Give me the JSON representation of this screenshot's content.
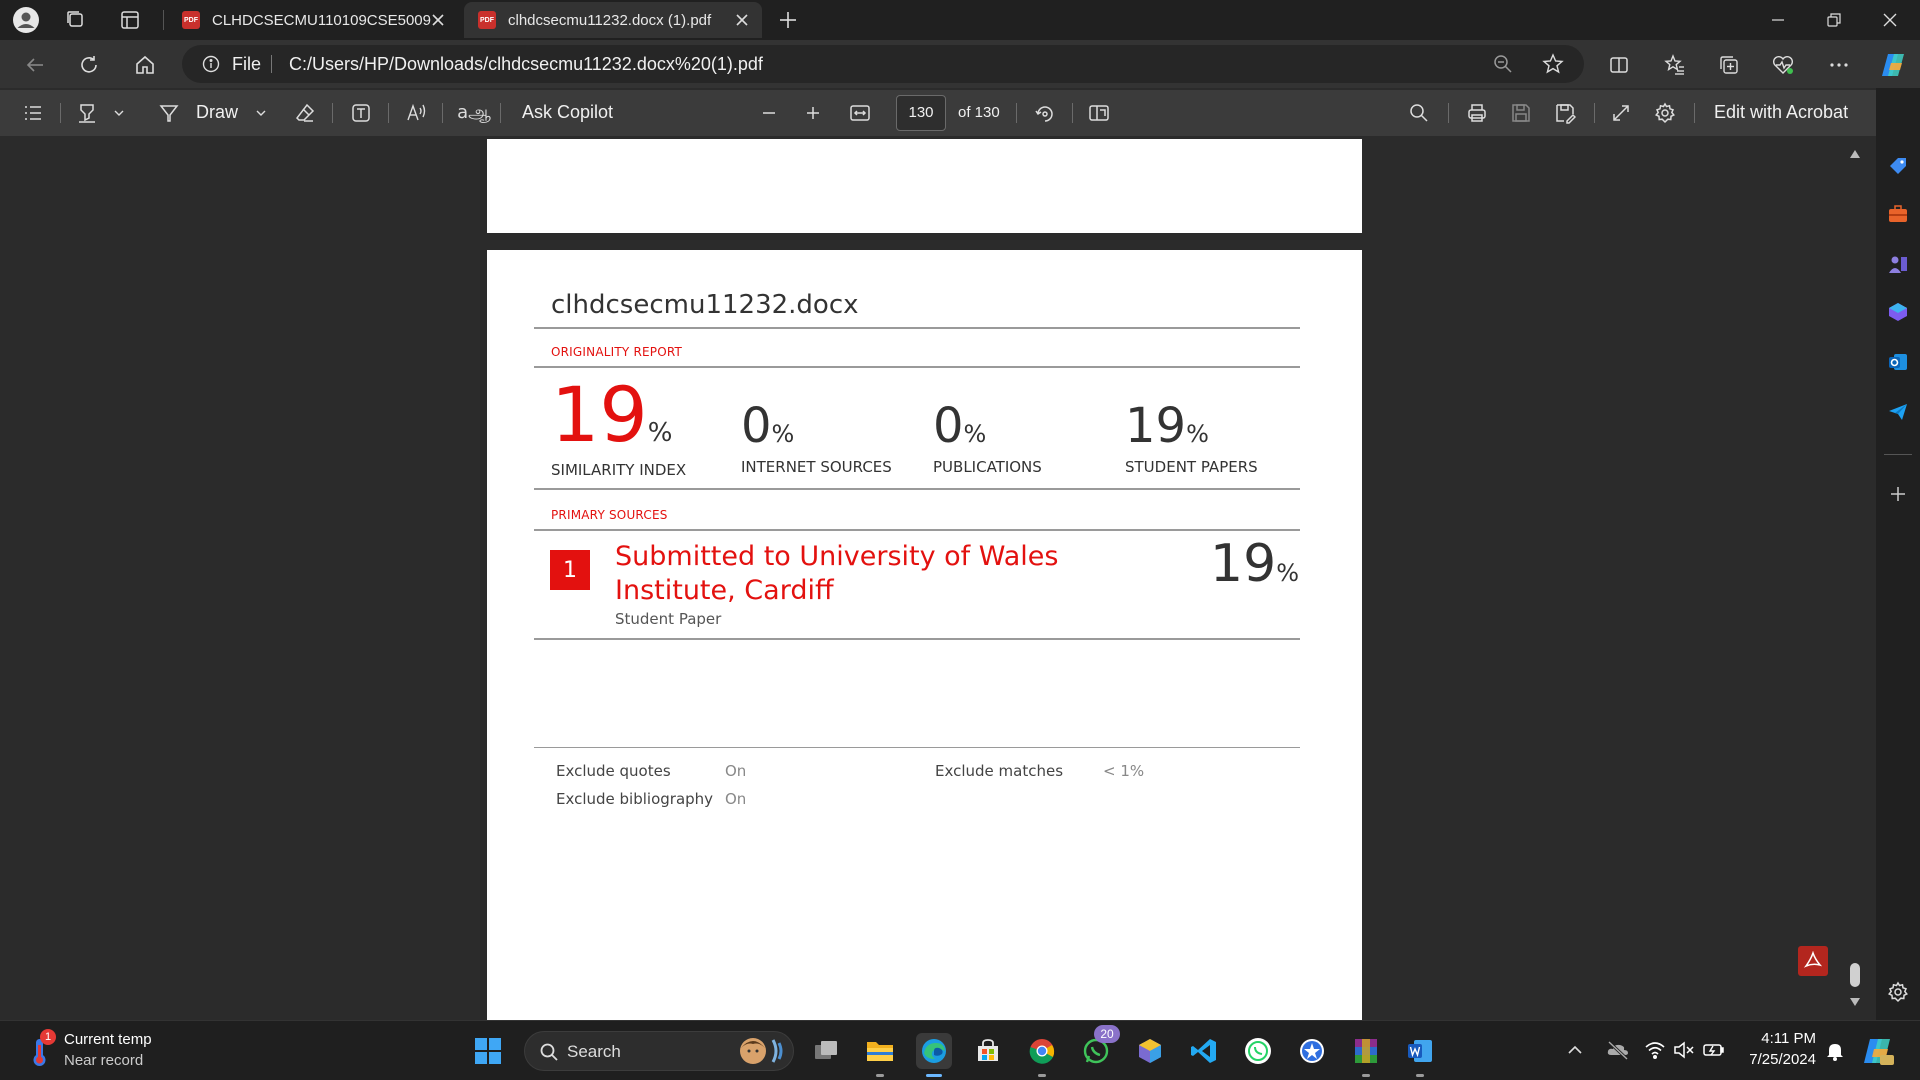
{
  "browser": {
    "tabs": [
      {
        "title": "CLHDCSECMU110109CSE5009.pdf",
        "active": false
      },
      {
        "title": "clhdcsecmu11232.docx (1).pdf",
        "active": true
      }
    ],
    "address_prefix": "File",
    "url": "C:/Users/HP/Downloads/clhdcsecmu11232.docx%20(1).pdf"
  },
  "pdf_toolbar": {
    "draw_label": "Draw",
    "ask_copilot_label": "Ask Copilot",
    "page_current": "130",
    "page_total_label": "of 130",
    "edit_label": "Edit with Acrobat"
  },
  "report": {
    "title": "clhdcsecmu11232.docx",
    "section_originality": "ORIGINALITY REPORT",
    "stats": [
      {
        "value": "19",
        "unit": "%",
        "label": "SIMILARITY INDEX"
      },
      {
        "value": "0",
        "unit": "%",
        "label": "INTERNET SOURCES"
      },
      {
        "value": "0",
        "unit": "%",
        "label": "PUBLICATIONS"
      },
      {
        "value": "19",
        "unit": "%",
        "label": "STUDENT PAPERS"
      }
    ],
    "section_primary": "PRIMARY SOURCES",
    "sources": [
      {
        "rank": "1",
        "name": "Submitted to University of Wales Institute, Cardiff",
        "type": "Student Paper",
        "percent": "19",
        "unit": "%"
      }
    ],
    "excludes": {
      "quotes_label": "Exclude quotes",
      "quotes_value": "On",
      "bibliography_label": "Exclude bibliography",
      "bibliography_value": "On",
      "matches_label": "Exclude matches",
      "matches_value": "< 1%"
    }
  },
  "taskbar": {
    "weather_title": "Current temp",
    "weather_subtitle": "Near record",
    "weather_badge": "1",
    "search_label": "Search",
    "whatsapp_badge": "20",
    "time": "4:11 PM",
    "date": "7/25/2024"
  },
  "colors": {
    "accent_red": "#e3110f",
    "edge_active": "#6cb8ff"
  }
}
